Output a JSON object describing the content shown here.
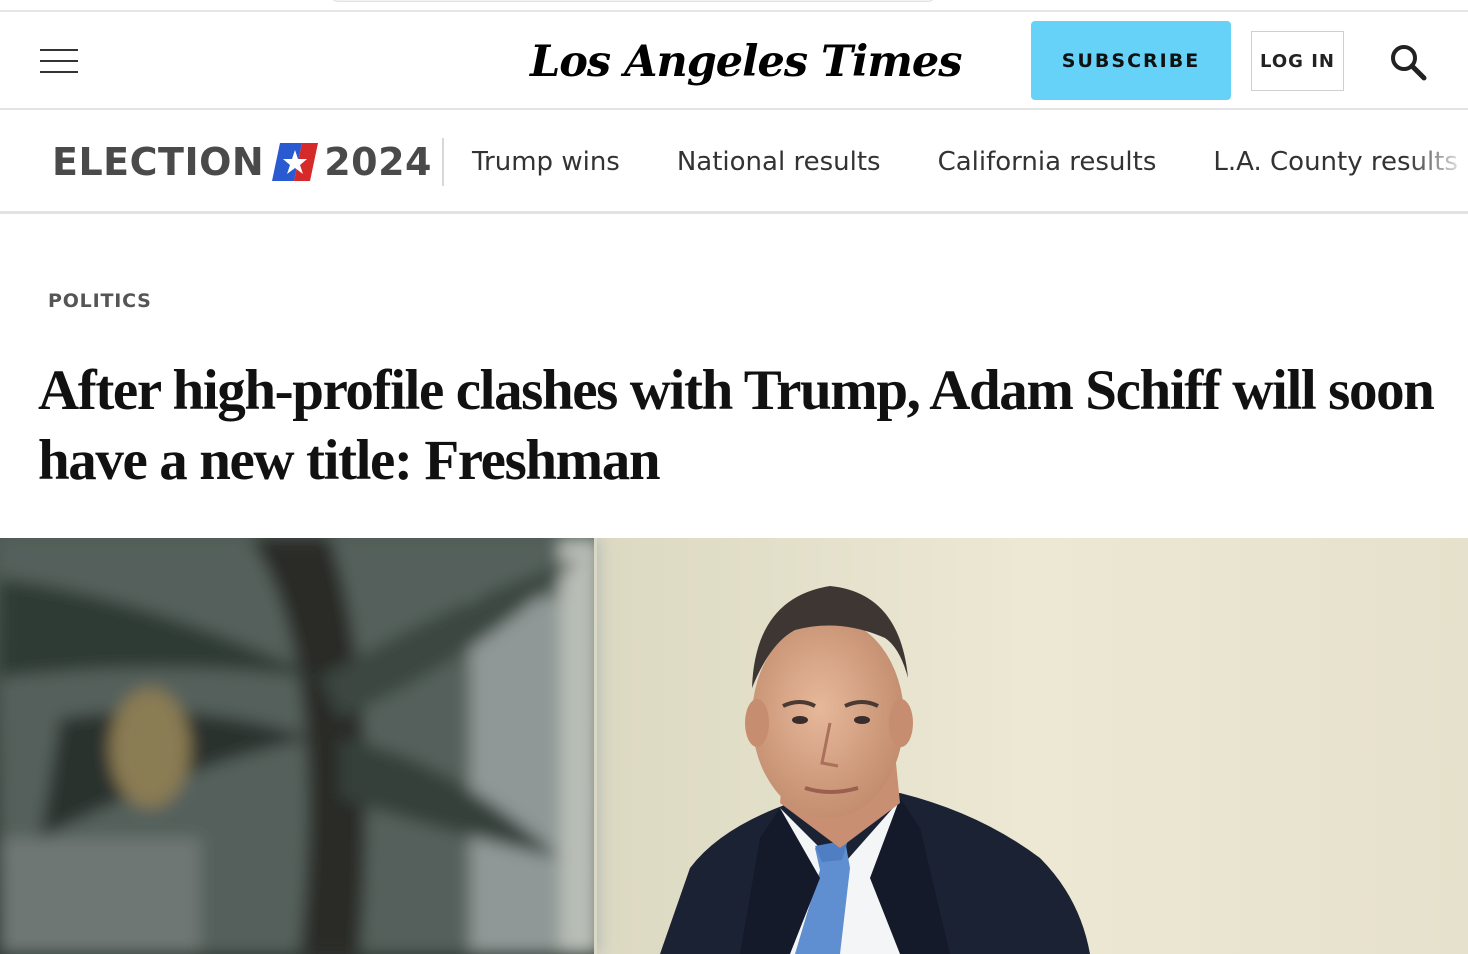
{
  "header": {
    "logo_text": "Los Angeles Times",
    "subscribe_label": "SUBSCRIBE",
    "login_label": "LOG IN",
    "icons": {
      "menu": "hamburger-menu-icon",
      "search": "search-icon"
    },
    "colors": {
      "subscribe_bg": "#66d2f8"
    }
  },
  "election_nav": {
    "logo_word": "ELECTION",
    "logo_year": "2024",
    "links": [
      {
        "label": "Trump wins"
      },
      {
        "label": "National results"
      },
      {
        "label": "California results"
      },
      {
        "label": "L.A. County results"
      }
    ],
    "colors": {
      "flag_blue": "#2a5ad1",
      "flag_red": "#d62a2a"
    }
  },
  "article": {
    "kicker": "POLITICS",
    "headline": "After high-profile clashes with Trump, Adam Schiff will soon have a new title: Freshman"
  }
}
